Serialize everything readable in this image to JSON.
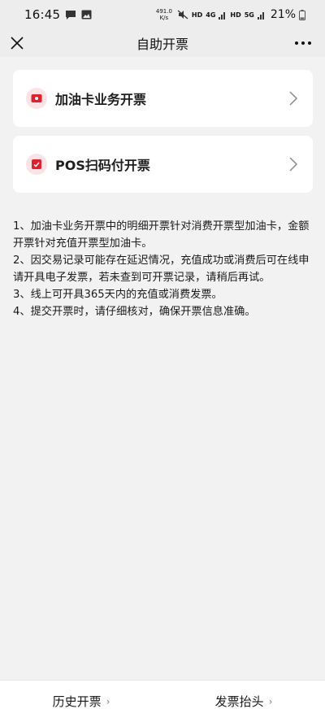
{
  "status_bar": {
    "time": "16:45",
    "net_speed_value": "491.0",
    "net_speed_unit": "K/s",
    "hd1": "HD",
    "sig1": "4G",
    "hd2": "HD",
    "sig2": "5G",
    "battery": "21%"
  },
  "nav": {
    "title": "自助开票",
    "close_icon": "close-icon",
    "more_icon": "more-icon"
  },
  "cards": [
    {
      "label": "加油卡业务开票",
      "icon": "card-icon"
    },
    {
      "label": "POS扫码付开票",
      "icon": "scan-icon"
    }
  ],
  "notes": [
    "1、加油卡业务开票中的明细开票针对消费开票型加油卡，金额开票针对充值开票型加油卡。",
    "2、因交易记录可能存在延迟情况，充值成功或消费后可在线申请开具电子发票，若未查到可开票记录，请稍后再试。",
    "3、线上可开具365天内的充值或消费发票。",
    "4、提交开票时，请仔细核对，确保开票信息准确。"
  ],
  "bottom": {
    "history_label": "历史开票",
    "header_label": "发票抬头"
  },
  "colors": {
    "accent": "#e0202e",
    "icon_bg": "#fbe3e5",
    "background": "#f2f2f2"
  }
}
